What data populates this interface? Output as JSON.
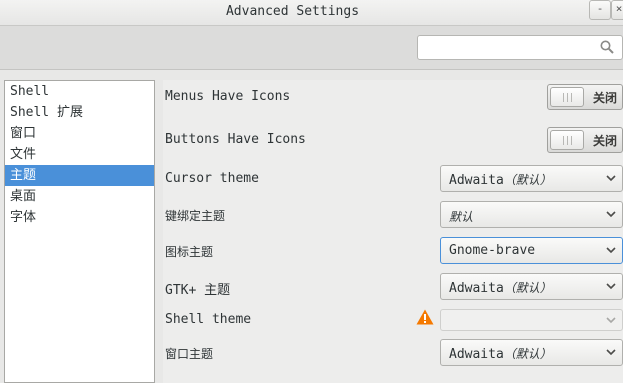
{
  "window": {
    "title": "Advanced Settings",
    "minimize_label": "-",
    "close_label": "×"
  },
  "search": {
    "placeholder": ""
  },
  "sidebar": {
    "items": [
      {
        "label": "Shell"
      },
      {
        "label": "Shell 扩展"
      },
      {
        "label": "窗口"
      },
      {
        "label": "文件"
      },
      {
        "label": "主题",
        "selected": true
      },
      {
        "label": "桌面"
      },
      {
        "label": "字体"
      }
    ]
  },
  "settings": {
    "menus_have_icons": {
      "label": "Menus Have Icons",
      "state": "关闭"
    },
    "buttons_have_icons": {
      "label": "Buttons Have Icons",
      "state": "关闭"
    },
    "cursor_theme": {
      "label": "Cursor theme",
      "value": "Adwaita",
      "suffix": "（默认）"
    },
    "keybinding_theme": {
      "label": "键绑定主题",
      "value": "默认"
    },
    "icon_theme": {
      "label": "图标主题",
      "value": "Gnome-brave"
    },
    "gtk_theme": {
      "label": "GTK+ 主题",
      "value": "Adwaita",
      "suffix": "（默认）"
    },
    "shell_theme": {
      "label": "Shell theme",
      "value": ""
    },
    "window_theme": {
      "label": "窗口主题",
      "value": "Adwaita",
      "suffix": "（默认）"
    }
  },
  "colors": {
    "selection": "#4a90d9",
    "warning": "#f57900"
  },
  "icons": {
    "search": "magnifier-icon",
    "warning": "warning-triangle-icon",
    "dropdown": "chevron-down-icon"
  }
}
